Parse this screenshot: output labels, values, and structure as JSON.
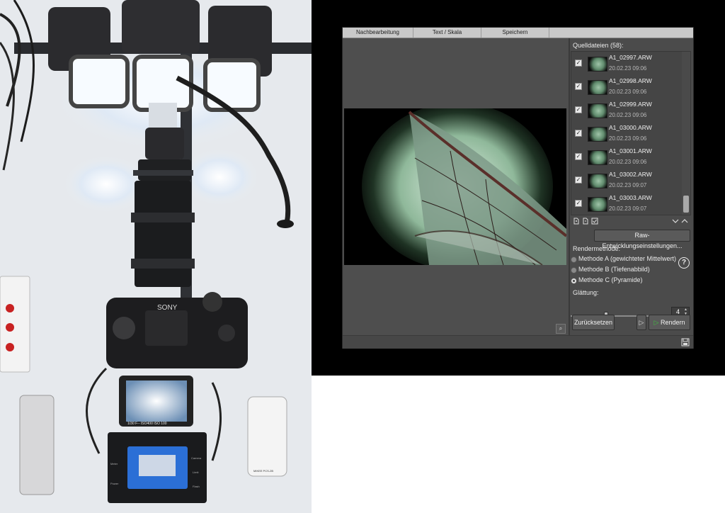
{
  "app": {
    "menu_tabs": [
      "Nachbearbeitung",
      "Text / Skala",
      "Speichern"
    ],
    "source_files_label": "Quelldateien (58):",
    "files": [
      {
        "name": "A1_02997.ARW",
        "date": "20.02.23 09:06",
        "checked": true
      },
      {
        "name": "A1_02998.ARW",
        "date": "20.02.23 09:06",
        "checked": true
      },
      {
        "name": "A1_02999.ARW",
        "date": "20.02.23 09:06",
        "checked": true
      },
      {
        "name": "A1_03000.ARW",
        "date": "20.02.23 09:06",
        "checked": true
      },
      {
        "name": "A1_03001.ARW",
        "date": "20.02.23 09:06",
        "checked": true
      },
      {
        "name": "A1_03002.ARW",
        "date": "20.02.23 09:07",
        "checked": true
      },
      {
        "name": "A1_03003.ARW",
        "date": "20.02.23 09:07",
        "checked": true
      }
    ],
    "raw_settings_button": "Raw-Entwicklungseinstellungen...",
    "render_method_label": "Rendermethode:",
    "methods": [
      {
        "label": "Methode A (gewichteter Mittelwert)",
        "selected": false
      },
      {
        "label": "Methode B (Tiefenabbild)",
        "selected": false
      },
      {
        "label": "Methode C (Pyramide)",
        "selected": true
      }
    ],
    "help_symbol": "?",
    "smoothing_label": "Glättung:",
    "smoothing_value": "4",
    "smoothing_level": 0.35,
    "reset_button": "Zurücksetzen",
    "render_button": "Rendern",
    "play_symbol": "▷"
  },
  "photo": {
    "camera_brand": "SONY",
    "remote_label": "MIKEE PCS-2B",
    "controller_labels": [
      "Meter",
      "Camera",
      "Limit",
      "Power",
      "Flash"
    ],
    "viewfinder_readout": "1/30   F--   ISO400   ISO 100"
  },
  "colors": {
    "app_bg": "#4b4b4b",
    "menubar_bg": "#c9c9c9",
    "accent_play": "#3fc23f"
  }
}
